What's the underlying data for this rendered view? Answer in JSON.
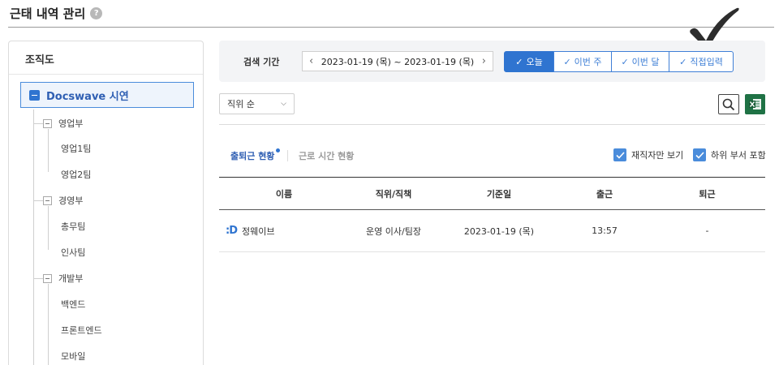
{
  "header": {
    "title": "근태 내역 관리",
    "help_icon": "?"
  },
  "org_panel": {
    "title": "조직도",
    "root": "Docswave 시연",
    "departments": [
      {
        "label": "영업부",
        "children": [
          "영업1팀",
          "영업2팀"
        ]
      },
      {
        "label": "경영부",
        "children": [
          "총무팀",
          "인사팀"
        ]
      },
      {
        "label": "개발부",
        "children": [
          "백엔드",
          "프론트엔드",
          "모바일"
        ]
      }
    ]
  },
  "search": {
    "label": "검색 기간",
    "date_range": "2023-01-19 (목) ~ 2023-01-19 (목)",
    "prev_arrow": "‹",
    "next_arrow": "›",
    "segments": [
      {
        "label": "오늘",
        "active": true
      },
      {
        "label": "이번 주",
        "active": false
      },
      {
        "label": "이번 달",
        "active": false
      },
      {
        "label": "직접입력",
        "active": false
      }
    ]
  },
  "toolbar": {
    "sort_selected": "직위 순"
  },
  "tabs": {
    "active": "출퇴근 현황",
    "inactive": "근로 시간 현황"
  },
  "options": {
    "employed_only": "재직자만 보기",
    "include_sub": "하위 부서 포함"
  },
  "table": {
    "headers": [
      "이름",
      "직위/직책",
      "기준일",
      "출근",
      "퇴근"
    ],
    "rows": [
      {
        "logo": ":D",
        "name": "정웨이브",
        "position": "운영 이사/팀장",
        "date": "2023-01-19 (목)",
        "clock_in": "13:57",
        "clock_out": "-"
      }
    ]
  },
  "colors": {
    "accent": "#2f74d0",
    "excel": "#1f7245"
  }
}
